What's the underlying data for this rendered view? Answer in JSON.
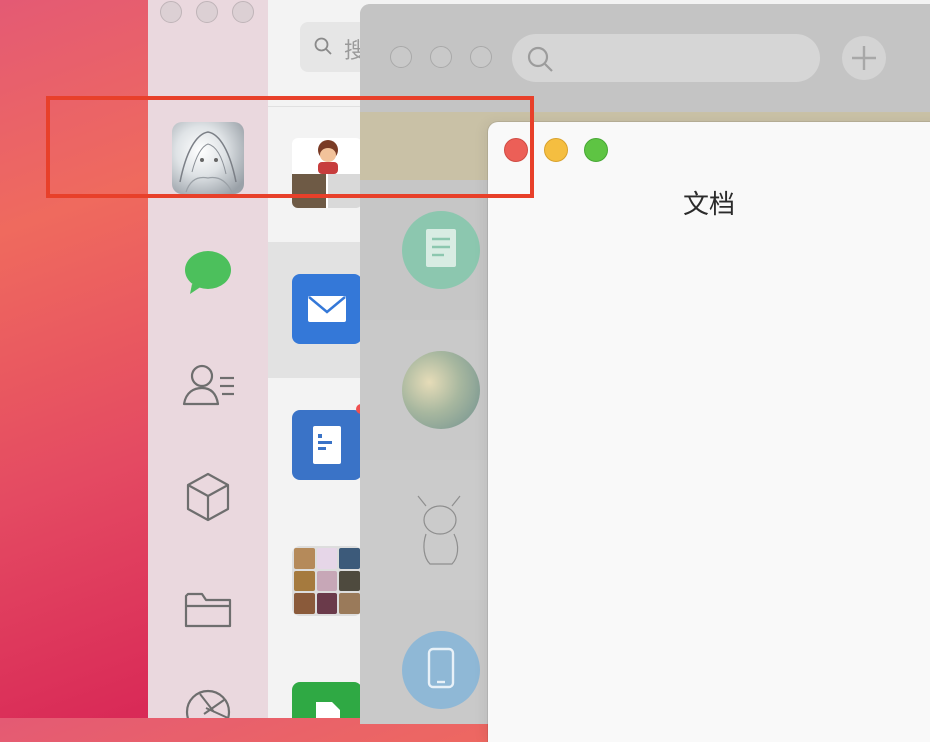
{
  "main_window": {
    "search_text": "搜",
    "traffic_lights": [
      "close",
      "minimize",
      "zoom"
    ],
    "nav_icons": [
      "avatar",
      "chat-icon",
      "contacts-icon",
      "cube-icon",
      "folder-icon",
      "camera-aperture-icon"
    ],
    "chat_badge_color": "#f05050"
  },
  "middle_window": {
    "search_placeholder": "",
    "add_label": "+"
  },
  "document_window": {
    "title": "文档",
    "traffic_lights": {
      "close": "#ec5f57",
      "minimize": "#f5be40",
      "zoom": "#5ec443"
    }
  },
  "highlight_color": "#e8402a"
}
